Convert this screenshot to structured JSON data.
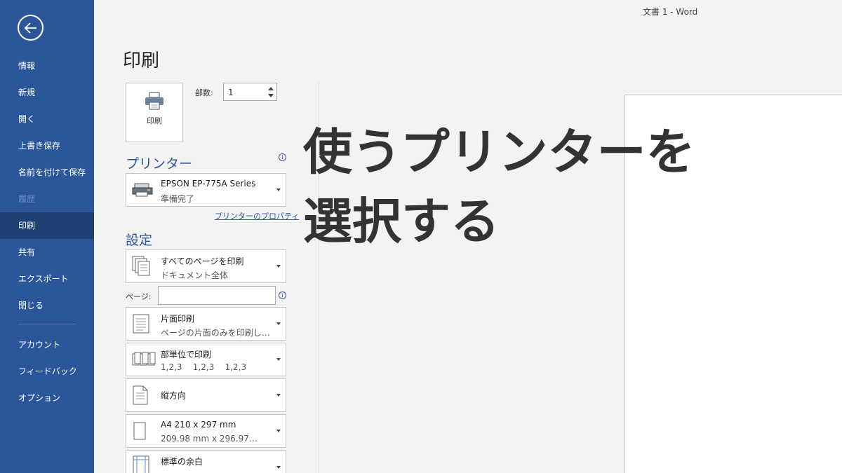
{
  "window": {
    "title": "文書 1  -  Word"
  },
  "sidebar": {
    "items": [
      {
        "label": "情報",
        "state": "normal"
      },
      {
        "label": "新規",
        "state": "normal"
      },
      {
        "label": "開く",
        "state": "normal"
      },
      {
        "label": "上書き保存",
        "state": "normal"
      },
      {
        "label": "名前を付けて保存",
        "state": "normal"
      },
      {
        "label": "履歴",
        "state": "disabled"
      },
      {
        "label": "印刷",
        "state": "active"
      },
      {
        "label": "共有",
        "state": "normal"
      },
      {
        "label": "エクスポート",
        "state": "normal"
      },
      {
        "label": "閉じる",
        "state": "normal"
      }
    ],
    "bottom_items": [
      {
        "label": "アカウント"
      },
      {
        "label": "フィードバック"
      },
      {
        "label": "オプション"
      }
    ]
  },
  "main": {
    "heading": "印刷",
    "print_button_label": "印刷",
    "copies": {
      "label": "部数:",
      "value": "1"
    },
    "printer": {
      "section_title": "プリンター",
      "name": "EPSON EP-775A Series",
      "status": "準備完了",
      "properties_link": "プリンターのプロパティ"
    },
    "settings": {
      "section_title": "設定",
      "print_range": {
        "line1": "すべてのページを印刷",
        "line2": "ドキュメント全体"
      },
      "pages": {
        "label": "ページ:",
        "value": ""
      },
      "sides": {
        "line1": "片面印刷",
        "line2": "ページの片面のみを印刷し…"
      },
      "collate": {
        "line1": "部単位で印刷",
        "line2": "1,2,3    1,2,3    1,2,3"
      },
      "orientation": {
        "line1": "縦方向"
      },
      "paper_size": {
        "line1": "A4 210 x 297 mm",
        "line2": "209.98 mm x 296.97…"
      },
      "margins": {
        "line1": "標準の余白"
      }
    }
  },
  "overlay": {
    "line1": "使うプリンターを",
    "line2": "選択する"
  },
  "colors": {
    "accent": "#2b579a",
    "active_nav": "#1e4173"
  }
}
